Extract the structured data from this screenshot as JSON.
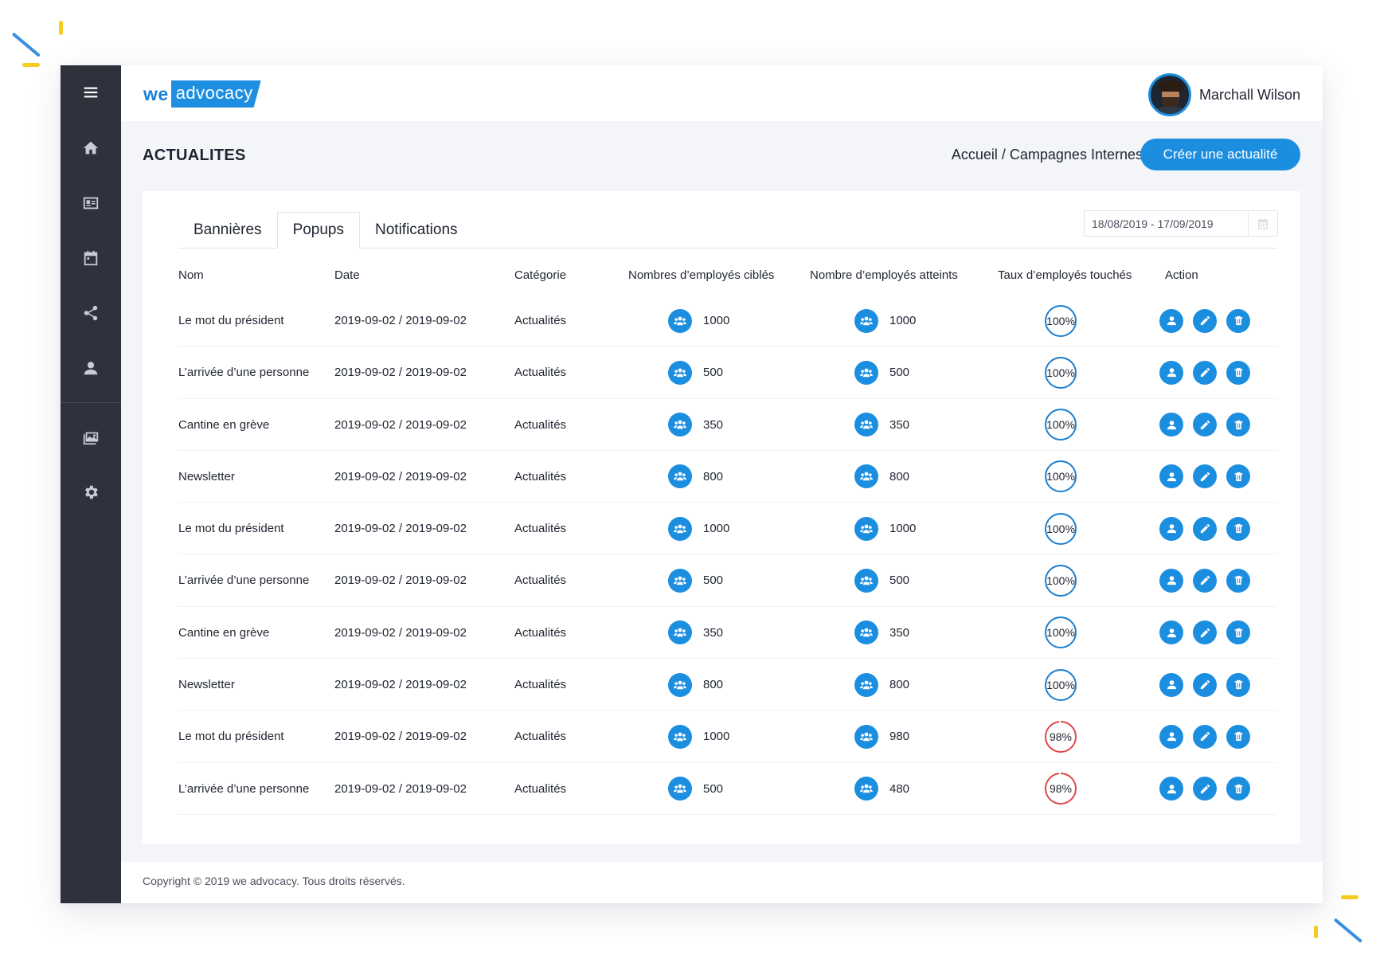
{
  "app": {
    "logo_we": "we",
    "logo_advocacy": "advocacy",
    "user_name": "Marchall Wilson"
  },
  "sidebar": {
    "icons": [
      "menu-icon",
      "home-icon",
      "id-card-icon",
      "calendar-icon",
      "share-icon",
      "user-icon",
      "images-icon",
      "gear-icon"
    ]
  },
  "header": {
    "title": "ACTUALITES",
    "breadcrumb": "Accueil / Campagnes Internes",
    "create_button": "Créer une actualité"
  },
  "tabs": [
    {
      "label": "Bannières",
      "active": false
    },
    {
      "label": "Popups",
      "active": true
    },
    {
      "label": "Notifications",
      "active": false
    }
  ],
  "date_range": "18/08/2019 - 17/09/2019",
  "table": {
    "columns": [
      "Nom",
      "Date",
      "Catégorie",
      "Nombres d’employés ciblés",
      "Nombre d’employés atteints",
      "Taux d’employés touchés",
      "Action"
    ],
    "rows": [
      {
        "nom": "Le mot du président",
        "date": "2019-09-02 / 2019-09-02",
        "categorie": "Actualités",
        "cibles": "1000",
        "atteints": "1000",
        "taux": "100%",
        "taux_value": 100
      },
      {
        "nom": "L’arrivée d’une personne",
        "date": "2019-09-02 / 2019-09-02",
        "categorie": "Actualités",
        "cibles": "500",
        "atteints": "500",
        "taux": "100%",
        "taux_value": 100
      },
      {
        "nom": "Cantine en grève",
        "date": "2019-09-02 / 2019-09-02",
        "categorie": "Actualités",
        "cibles": "350",
        "atteints": "350",
        "taux": "100%",
        "taux_value": 100
      },
      {
        "nom": "Newsletter",
        "date": "2019-09-02 / 2019-09-02",
        "categorie": "Actualités",
        "cibles": "800",
        "atteints": "800",
        "taux": "100%",
        "taux_value": 100
      },
      {
        "nom": "Le mot du président",
        "date": "2019-09-02 / 2019-09-02",
        "categorie": "Actualités",
        "cibles": "1000",
        "atteints": "1000",
        "taux": "100%",
        "taux_value": 100
      },
      {
        "nom": "L’arrivée d’une personne",
        "date": "2019-09-02 / 2019-09-02",
        "categorie": "Actualités",
        "cibles": "500",
        "atteints": "500",
        "taux": "100%",
        "taux_value": 100
      },
      {
        "nom": "Cantine en grève",
        "date": "2019-09-02 / 2019-09-02",
        "categorie": "Actualités",
        "cibles": "350",
        "atteints": "350",
        "taux": "100%",
        "taux_value": 100
      },
      {
        "nom": "Newsletter",
        "date": "2019-09-02 / 2019-09-02",
        "categorie": "Actualités",
        "cibles": "800",
        "atteints": "800",
        "taux": "100%",
        "taux_value": 100
      },
      {
        "nom": "Le mot du président",
        "date": "2019-09-02 / 2019-09-02",
        "categorie": "Actualités",
        "cibles": "1000",
        "atteints": "980",
        "taux": "98%",
        "taux_value": 98
      },
      {
        "nom": "L’arrivée d’une personne",
        "date": "2019-09-02 / 2019-09-02",
        "categorie": "Actualités",
        "cibles": "500",
        "atteints": "480",
        "taux": "98%",
        "taux_value": 98
      }
    ]
  },
  "colors": {
    "accent": "#1c8ee0",
    "sidebar_bg": "#2f323d",
    "ring_full": "#1c7fd0",
    "ring_partial": "#e04848"
  },
  "footer": {
    "copyright": "Copyright © 2019 we advocacy. Tous droits réservés."
  }
}
